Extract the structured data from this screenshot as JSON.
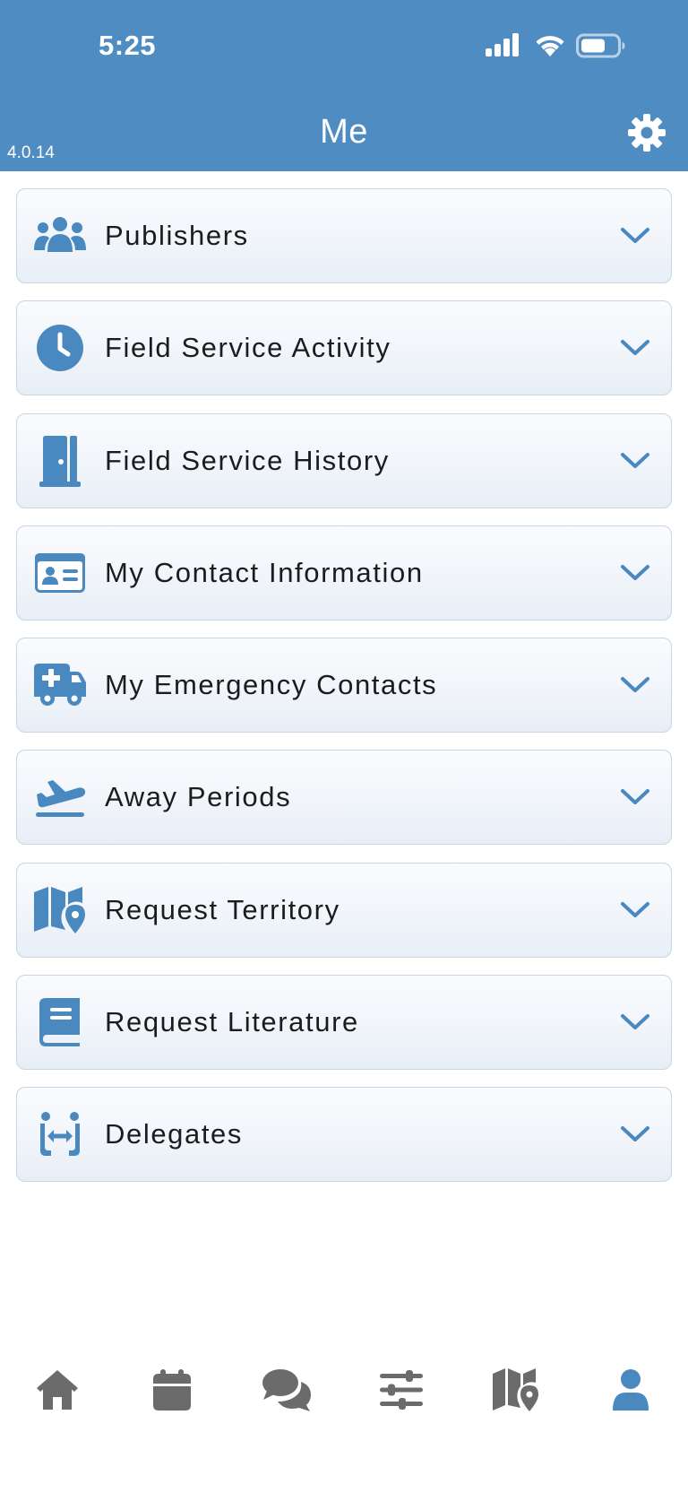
{
  "status_bar": {
    "time": "5:25",
    "icons": [
      "signal-icon",
      "wifi-icon",
      "battery-icon"
    ]
  },
  "header": {
    "title": "Me",
    "version": "4.0.14",
    "settings_icon": "gear-icon"
  },
  "colors": {
    "brand": "#4e8cc2",
    "icon_accent": "#4a88c0",
    "tab_inactive": "#6b6b6b",
    "tab_active": "#4a88c0",
    "text": "#1c1c1e"
  },
  "menu": {
    "items": [
      {
        "label": "Publishers",
        "icon": "people-group-icon"
      },
      {
        "label": "Field Service Activity",
        "icon": "clock-icon"
      },
      {
        "label": "Field Service History",
        "icon": "door-icon"
      },
      {
        "label": "My Contact Information",
        "icon": "id-card-icon"
      },
      {
        "label": "My Emergency Contacts",
        "icon": "ambulance-icon"
      },
      {
        "label": "Away Periods",
        "icon": "plane-departure-icon"
      },
      {
        "label": "Request Territory",
        "icon": "map-location-icon"
      },
      {
        "label": "Request Literature",
        "icon": "book-icon"
      },
      {
        "label": "Delegates",
        "icon": "people-arrows-icon"
      }
    ]
  },
  "tabbar": {
    "tabs": [
      {
        "name": "home",
        "icon": "home-icon",
        "active": false
      },
      {
        "name": "calendar",
        "icon": "calendar-icon",
        "active": false
      },
      {
        "name": "messages",
        "icon": "chat-bubbles-icon",
        "active": false
      },
      {
        "name": "settings-sliders",
        "icon": "sliders-icon",
        "active": false
      },
      {
        "name": "territories",
        "icon": "map-location-icon",
        "active": false
      },
      {
        "name": "me",
        "icon": "user-icon",
        "active": true
      }
    ]
  }
}
